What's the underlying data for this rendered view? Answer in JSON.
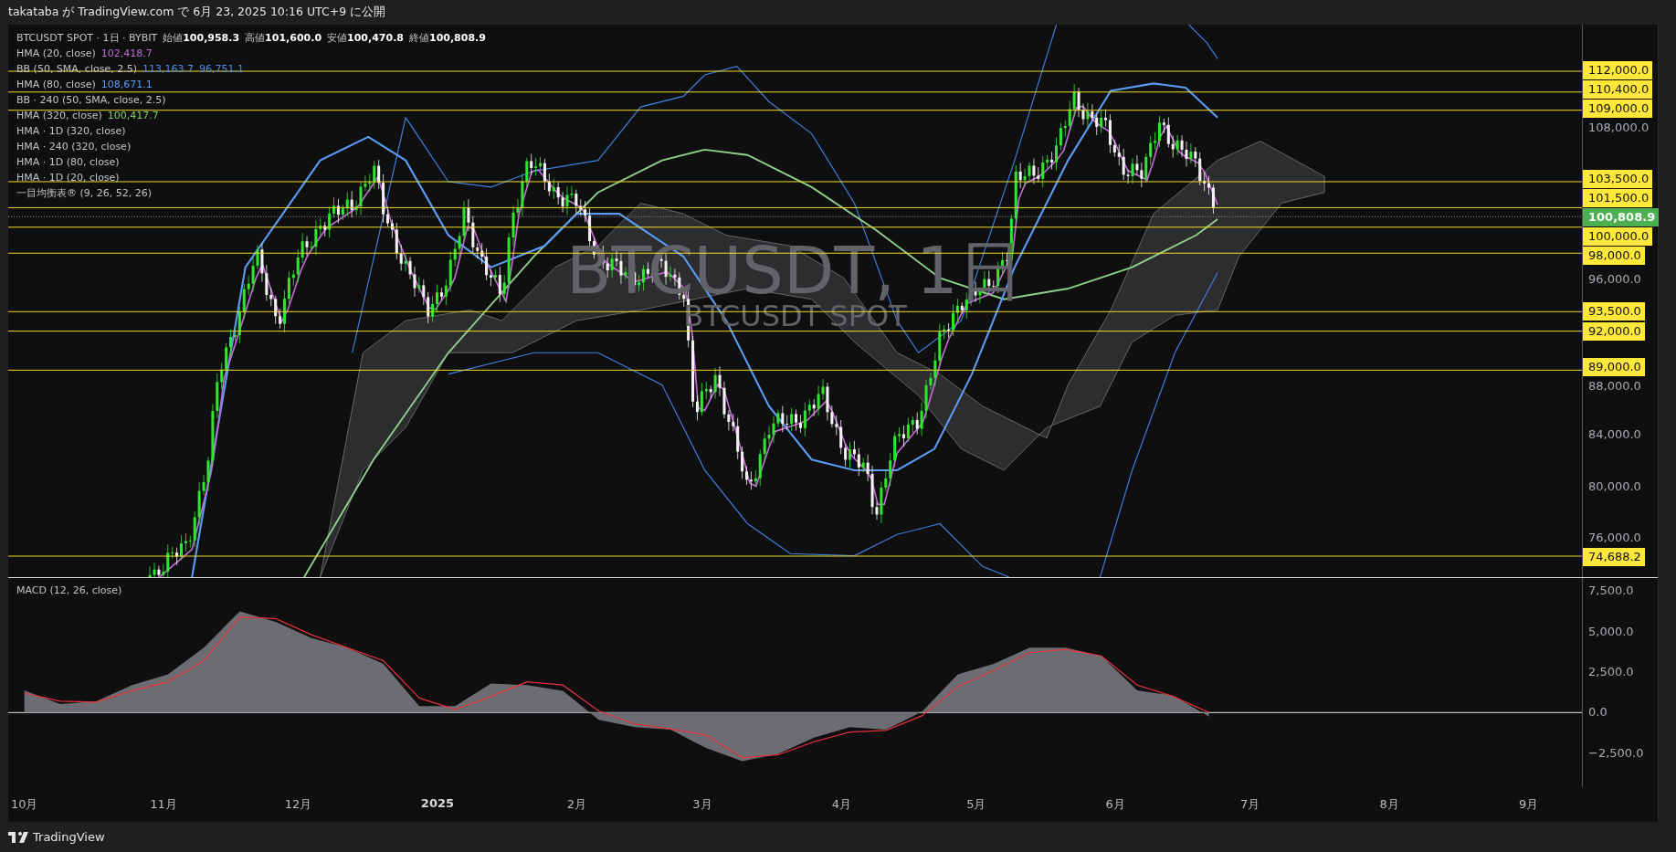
{
  "header": {
    "text": "takataba が TradingView.com で 6月 23, 2025 10:16 UTC+9 に公開"
  },
  "main_chart": {
    "symbol": "BTCUSDT SPOT · 1日 · BYBIT",
    "ohlc": [
      "始値**100,958.3**",
      "高値**101,600.0**",
      "安値**100,470.8**",
      "終値**100,808.9**"
    ],
    "indicators": [
      {
        "name": "HMA (20, close)",
        "values": [
          {
            "text": "102,418.7",
            "color": "#c36ad6"
          }
        ]
      },
      {
        "name": "BB (50, SMA, close, 2.5)",
        "values": [
          {
            "text": "113,163.7",
            "color": "#4a8fe8"
          },
          {
            "text": "96,751.1",
            "color": "#4a8fe8"
          }
        ]
      },
      {
        "name": "HMA (80, close)",
        "values": [
          {
            "text": "108,671.1",
            "color": "#5a9cf5"
          }
        ]
      },
      {
        "name": "BB · 240 (50, SMA, close, 2.5)"
      },
      {
        "name": "HMA (320, close)",
        "values": [
          {
            "text": "100,417.7",
            "color": "#7fcc72"
          }
        ]
      },
      {
        "name": "HMA · 1D (320, close)"
      },
      {
        "name": "HMA · 240 (320, close)"
      },
      {
        "name": "HMA · 1D (80, close)"
      },
      {
        "name": "HMA · 1D (20, close)"
      },
      {
        "name": "一目均衡表® (9, 26, 52, 26)"
      }
    ],
    "watermark": {
      "title": "BTCUSDT, 1日",
      "subtitle": "BTCUSDT SPOT"
    },
    "price_axis": [
      {
        "text": "112,000.0",
        "kind": "level"
      },
      {
        "text": "110,400.0",
        "kind": "level"
      },
      {
        "text": "109,000.0",
        "kind": "level"
      },
      {
        "text": "108,000.0",
        "kind": "tick"
      },
      {
        "text": "103,500.0",
        "kind": "level"
      },
      {
        "text": "101,500.0",
        "kind": "level"
      },
      {
        "text": "100,808.9",
        "kind": "last_price"
      },
      {
        "text": "100,000.0",
        "kind": "level"
      },
      {
        "text": "98,000.0",
        "kind": "level"
      },
      {
        "text": "96,000.0",
        "kind": "tick"
      },
      {
        "text": "93,500.0",
        "kind": "level"
      },
      {
        "text": "92,000.0",
        "kind": "level"
      },
      {
        "text": "89,000.0",
        "kind": "level"
      },
      {
        "text": "88,000.0",
        "kind": "tick"
      },
      {
        "text": "84,000.0",
        "kind": "tick"
      },
      {
        "text": "80,000.0",
        "kind": "tick"
      },
      {
        "text": "76,000.0",
        "kind": "tick"
      },
      {
        "text": "74,688.2",
        "kind": "level"
      }
    ]
  },
  "macd": {
    "title": "MACD (12, 26, close)",
    "axis_labels": [
      "7,500.0",
      "5,000.0",
      "2,500.0",
      "0.0",
      "−2,500.0"
    ]
  },
  "time_axis": [
    {
      "text": "10月",
      "kind": "month"
    },
    {
      "text": "11月",
      "kind": "month"
    },
    {
      "text": "12月",
      "kind": "month"
    },
    {
      "text": "2025",
      "kind": "year"
    },
    {
      "text": "2月",
      "kind": "month"
    },
    {
      "text": "3月",
      "kind": "month"
    },
    {
      "text": "4月",
      "kind": "month"
    },
    {
      "text": "5月",
      "kind": "month"
    },
    {
      "text": "6月",
      "kind": "month"
    },
    {
      "text": "7月",
      "kind": "month"
    },
    {
      "text": "8月",
      "kind": "month"
    },
    {
      "text": "9月",
      "kind": "month"
    }
  ],
  "footer": {
    "brand": "TradingView"
  }
}
